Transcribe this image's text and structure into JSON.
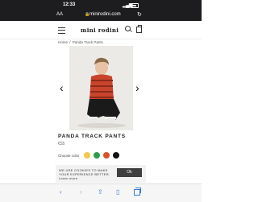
{
  "status_bar": {
    "time": "12:33"
  },
  "browser": {
    "aa_label": "AA",
    "url": "minirodini.com"
  },
  "header": {
    "logo": "mini rodini"
  },
  "breadcrumb": {
    "home": "Home",
    "separator": "/",
    "current": "Panda Track Pants"
  },
  "product": {
    "title": "PANDA TRACK PANTS",
    "price": "€55",
    "colour_label": "Choose color",
    "colours": [
      "#f2c94c",
      "#2e9e4a",
      "#d9532c",
      "#111111"
    ]
  },
  "cookie": {
    "message": "WE USE COOKIES TO MAKE YOUR EXPERIENCE BETTER. Learn more",
    "ok_label": "Ok"
  },
  "gallery": {
    "prev_icon": "‹",
    "next_icon": "›"
  }
}
